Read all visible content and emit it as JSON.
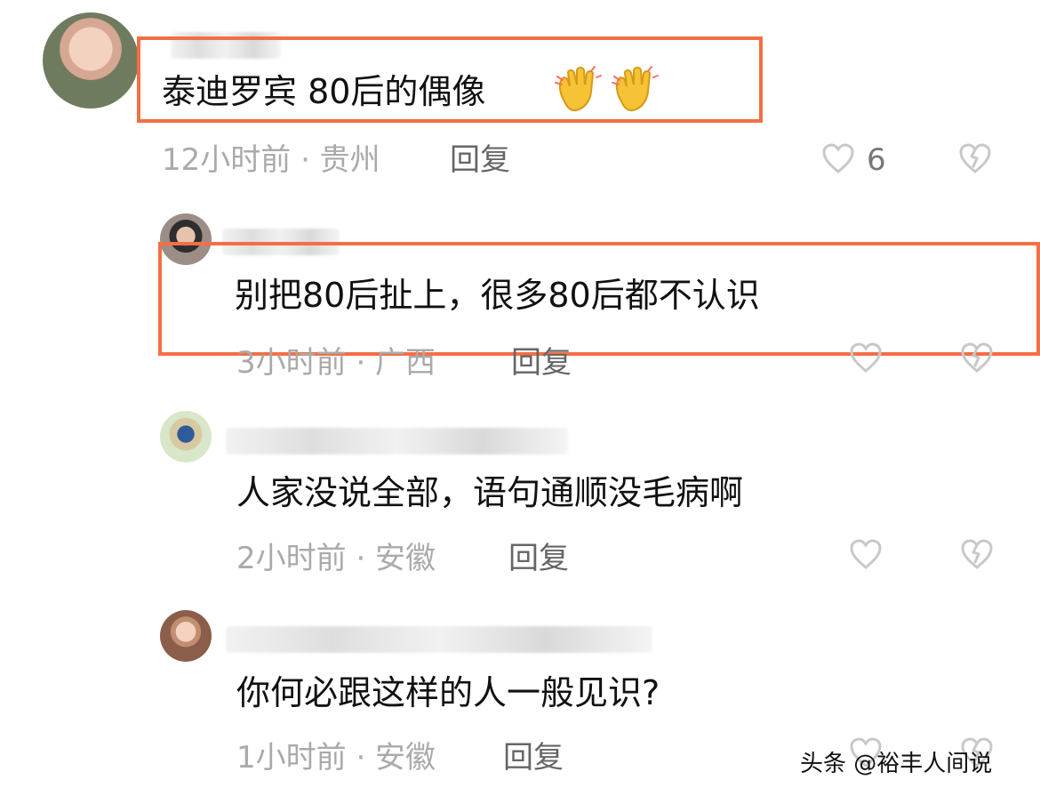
{
  "comments": [
    {
      "text": "泰迪罗宾 80后的偶像",
      "meta": "12小时前 · 贵州",
      "reply": "回复",
      "likes": "6",
      "reaction_icons": [
        "clap-icon",
        "clap-icon"
      ]
    },
    {
      "text": "别把80后扯上，很多80后都不认识",
      "meta": "3小时前 · 广西",
      "reply": "回复"
    },
    {
      "text": "人家没说全部，语句通顺没毛病啊",
      "meta": "2小时前 · 安徽",
      "reply": "回复"
    },
    {
      "text": "你何必跟这样的人一般见识?",
      "meta": "1小时前 · 安徽",
      "reply": "回复"
    }
  ],
  "watermark": "头条 @裕丰人间说",
  "colors": {
    "highlight": "#f36f45",
    "meta": "#aaaaaa",
    "reply": "#666666",
    "icon": "#c8c8c8"
  },
  "icons": {
    "like": "heart-icon",
    "dislike": "broken-heart-icon",
    "clap": "clap-icon"
  }
}
